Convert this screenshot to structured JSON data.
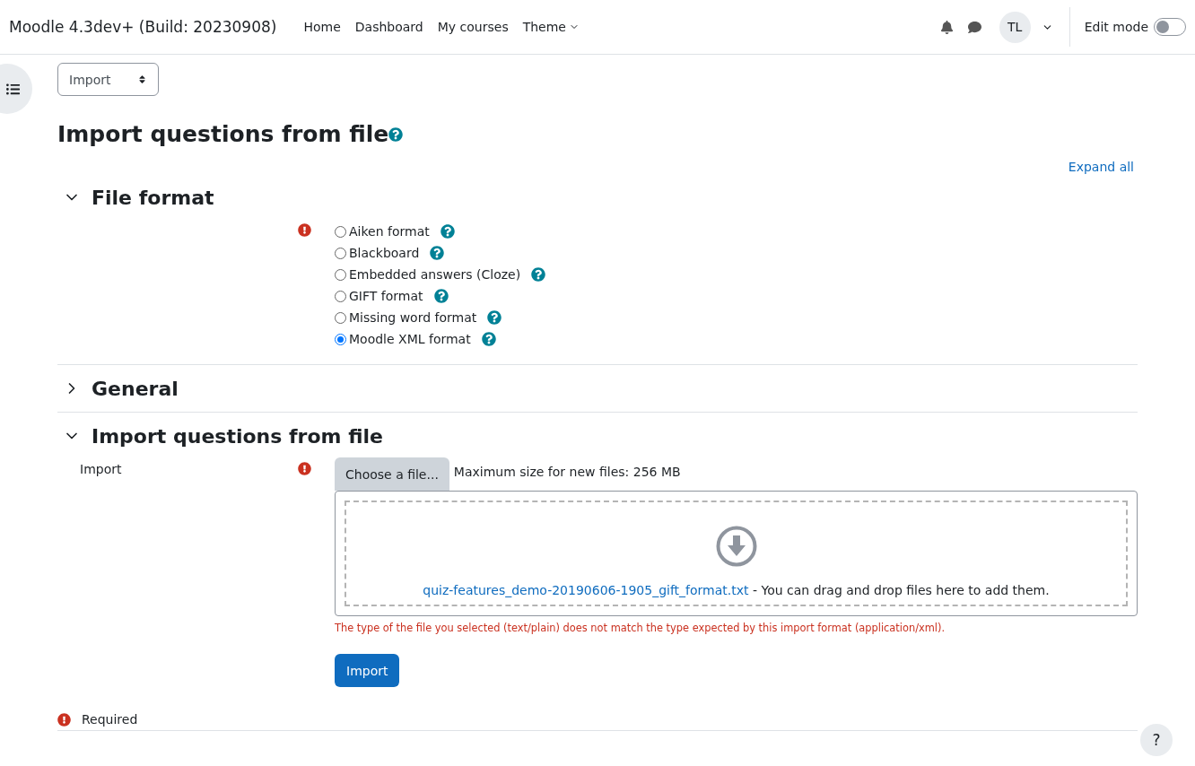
{
  "navbar": {
    "brand": "Moodle 4.3dev+ (Build: 20230908)",
    "links": [
      "Home",
      "Dashboard",
      "My courses"
    ],
    "menu": "Theme",
    "avatar": "TL",
    "edit_mode": {
      "label": "Edit mode",
      "on": false
    }
  },
  "action_select": "Import",
  "title": "Import questions from file",
  "expand_all": "Expand all",
  "sections": [
    {
      "kind": "formats",
      "title": "File format",
      "expanded": true,
      "required": true,
      "options": [
        {
          "label": "Aiken format",
          "selected": false
        },
        {
          "label": "Blackboard",
          "selected": false
        },
        {
          "label": "Embedded answers (Cloze)",
          "selected": false
        },
        {
          "label": "GIFT format",
          "selected": false
        },
        {
          "label": "Missing word format",
          "selected": false
        },
        {
          "label": "Moodle XML format",
          "selected": true
        }
      ]
    },
    {
      "title": "General",
      "expanded": false
    },
    {
      "kind": "upload",
      "title": "Import questions from file",
      "expanded": true,
      "label": "Import",
      "required": true,
      "choose_button": "Choose a file...",
      "max_size": "Maximum size for new files: 256 MB",
      "file_name": "quiz-features_demo-20190606-1905_gift_format.txt",
      "drop_hint": " - You can drag and drop files here to add them.",
      "error": "The type of the file you selected (text/plain) does not match the type expected by this import format (application/xml)."
    }
  ],
  "submit": "Import",
  "required_note": "Required",
  "help_button": "?"
}
